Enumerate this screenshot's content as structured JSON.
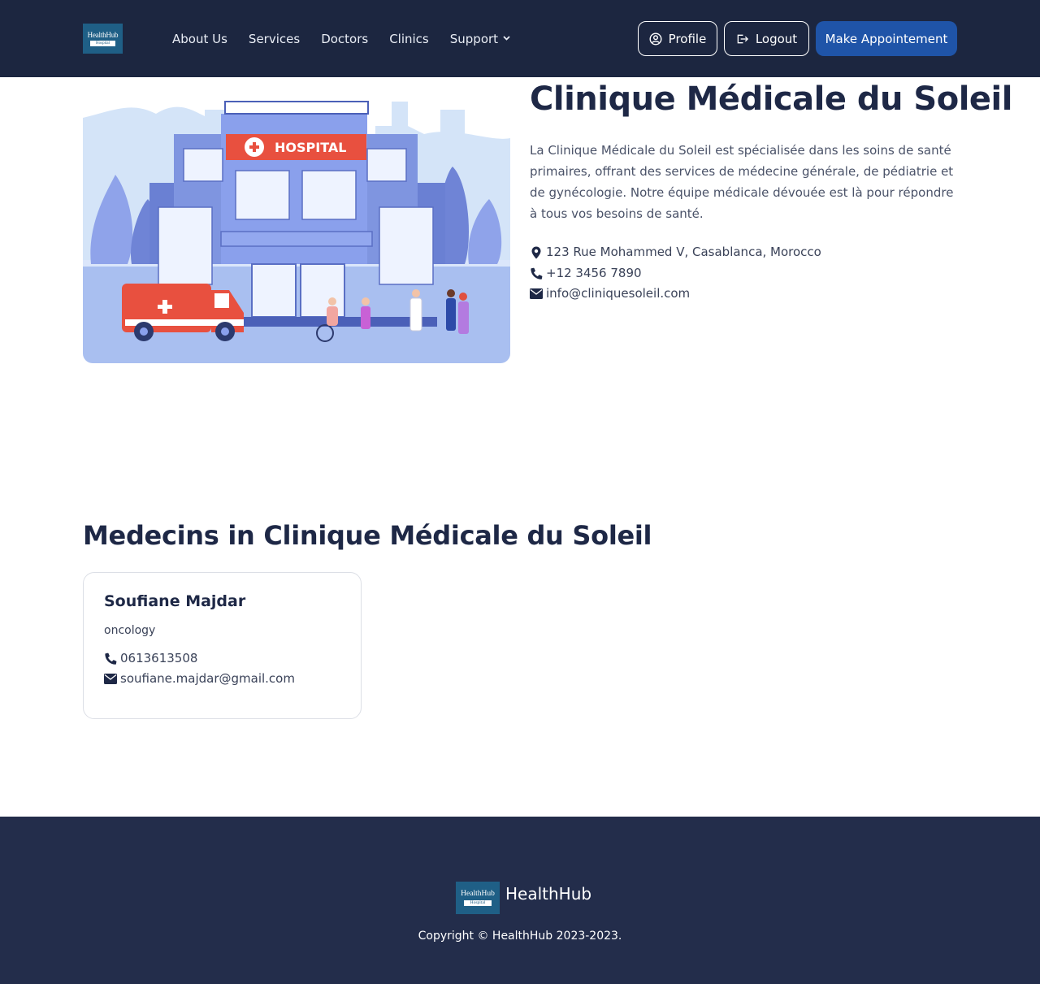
{
  "navbar": {
    "logo": {
      "line1": "HealthHub",
      "line2": "Hospital"
    },
    "links": [
      "About Us",
      "Services",
      "Doctors",
      "Clinics",
      "Support"
    ],
    "profile_label": "Profile",
    "logout_label": "Logout",
    "cta_label": "Make Appointement"
  },
  "clinic": {
    "image_label": "HOSPITAL",
    "name": "Clinique Médicale du Soleil",
    "description": "La Clinique Médicale du Soleil est spécialisée dans les soins de santé primaires, offrant des services de médecine générale, de pédiatrie et de gynécologie. Notre équipe médicale dévouée est là pour répondre à tous vos besoins de santé.",
    "address": "123 Rue Mohammed V, Casablanca, Morocco",
    "phone": "+12 3456 7890",
    "email": "info@cliniquesoleil.com"
  },
  "doctors_section": {
    "title": "Medecins in Clinique Médicale du Soleil",
    "doctors": [
      {
        "name": "Soufiane Majdar",
        "specialty": "oncology",
        "phone": "0613613508",
        "email": "soufiane.majdar@gmail.com"
      }
    ]
  },
  "footer": {
    "logo": {
      "line1": "HealthHub",
      "line2": "Hospital"
    },
    "brand": "HealthHub",
    "copyright": "Copyright © HealthHub 2023-2023."
  },
  "colors": {
    "navbar_bg": "#1c2640",
    "footer_bg": "#232d4b",
    "primary": "#1f54a8",
    "heading": "#1e2846"
  },
  "icons": {
    "profile": "user-circle-icon",
    "logout": "logout-icon",
    "address": "map-marker-icon",
    "phone": "phone-icon",
    "email": "envelope-icon",
    "support": "chevron-down-icon"
  }
}
